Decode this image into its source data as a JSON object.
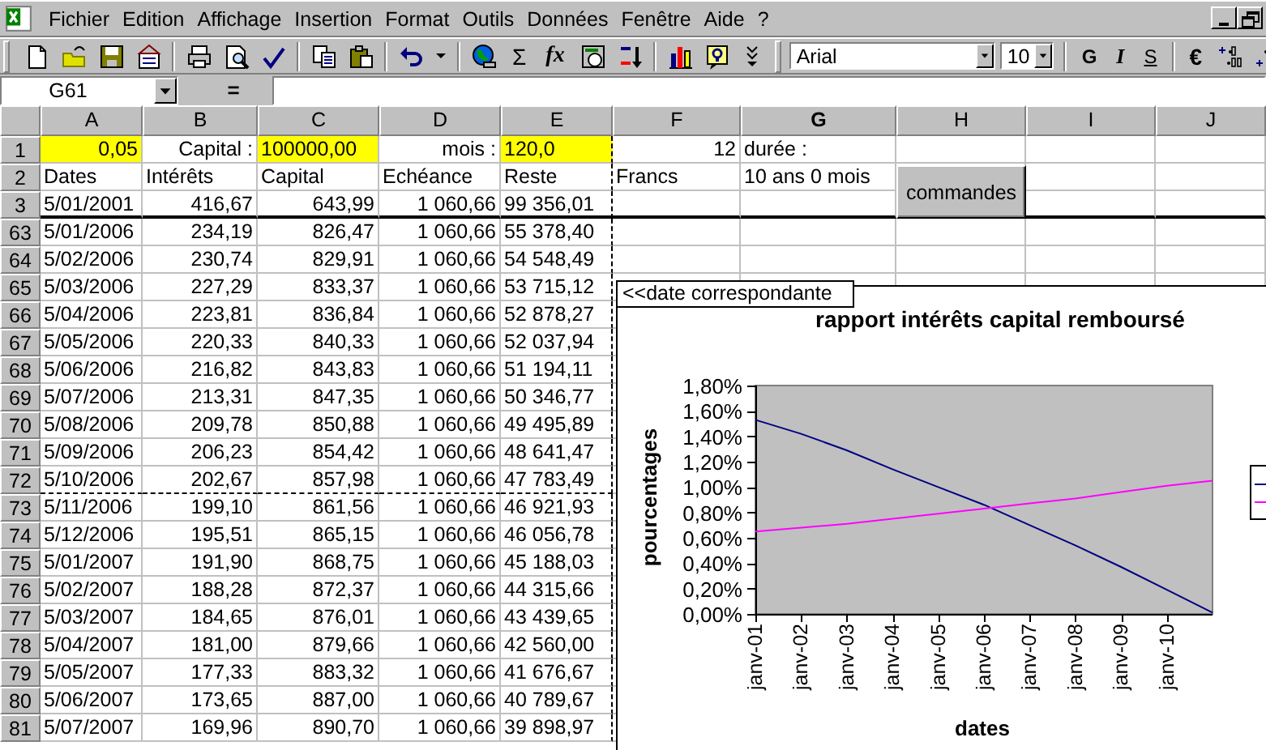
{
  "menu": {
    "items": [
      "Fichier",
      "Edition",
      "Affichage",
      "Insertion",
      "Format",
      "Outils",
      "Données",
      "Fenêtre",
      "Aide",
      "?"
    ]
  },
  "toolbar": {
    "sum": "Σ",
    "function": "fx"
  },
  "formatting_toolbar": {
    "font": "Arial",
    "size": "10",
    "bold": "G",
    "italic": "I",
    "underline": "S",
    "euro": "€"
  },
  "formula_bar": {
    "name_box": "G61",
    "equals": "="
  },
  "sheet": {
    "columns": [
      {
        "label": "A",
        "selected": false
      },
      {
        "label": "B",
        "selected": false
      },
      {
        "label": "C",
        "selected": false
      },
      {
        "label": "D",
        "selected": false
      },
      {
        "label": "E",
        "selected": false
      },
      {
        "label": "F",
        "selected": false
      },
      {
        "label": "G",
        "selected": true
      },
      {
        "label": "H",
        "selected": false
      },
      {
        "label": "I",
        "selected": false
      },
      {
        "label": "J",
        "selected": false
      }
    ],
    "rows": [
      {
        "header": "1",
        "kind": "params",
        "cells": [
          {
            "text": "0,05",
            "highlighted": true
          },
          {
            "text": "Capital :",
            "highlighted": false
          },
          {
            "text": "100000,00",
            "highlighted": true
          },
          {
            "text": "mois :",
            "highlighted": false
          },
          {
            "text": "120,0",
            "highlighted": true
          },
          {
            "text": "12",
            "highlighted": false
          },
          {
            "text": "durée :",
            "highlighted": false
          }
        ]
      },
      {
        "header": "2",
        "kind": "labels",
        "cells": [
          "Dates",
          "Intérêts",
          "Capital",
          "Echéance",
          "Reste",
          "Francs",
          "10 ans 0 mois"
        ]
      },
      {
        "header": "3",
        "kind": "data",
        "cells": [
          "5/01/2001",
          "416,67",
          "643,99",
          "1 060,66",
          "99 356,01"
        ]
      },
      {
        "header": "63",
        "kind": "data",
        "cells": [
          "5/01/2006",
          "234,19",
          "826,47",
          "1 060,66",
          "55 378,40"
        ]
      },
      {
        "header": "64",
        "kind": "data",
        "cells": [
          "5/02/2006",
          "230,74",
          "829,91",
          "1 060,66",
          "54 548,49"
        ]
      },
      {
        "header": "65",
        "kind": "data",
        "cells": [
          "5/03/2006",
          "227,29",
          "833,37",
          "1 060,66",
          "53 715,12"
        ]
      },
      {
        "header": "66",
        "kind": "data",
        "cells": [
          "5/04/2006",
          "223,81",
          "836,84",
          "1 060,66",
          "52 878,27"
        ]
      },
      {
        "header": "67",
        "kind": "data",
        "cells": [
          "5/05/2006",
          "220,33",
          "840,33",
          "1 060,66",
          "52 037,94"
        ]
      },
      {
        "header": "68",
        "kind": "data",
        "cells": [
          "5/06/2006",
          "216,82",
          "843,83",
          "1 060,66",
          "51 194,11"
        ]
      },
      {
        "header": "69",
        "kind": "data",
        "cells": [
          "5/07/2006",
          "213,31",
          "847,35",
          "1 060,66",
          "50 346,77"
        ]
      },
      {
        "header": "70",
        "kind": "data",
        "cells": [
          "5/08/2006",
          "209,78",
          "850,88",
          "1 060,66",
          "49 495,89"
        ]
      },
      {
        "header": "71",
        "kind": "data",
        "cells": [
          "5/09/2006",
          "206,23",
          "854,42",
          "1 060,66",
          "48 641,47"
        ]
      },
      {
        "header": "72",
        "kind": "data",
        "cells": [
          "5/10/2006",
          "202,67",
          "857,98",
          "1 060,66",
          "47 783,49"
        ]
      },
      {
        "header": "73",
        "kind": "data",
        "cells": [
          "5/11/2006",
          "199,10",
          "861,56",
          "1 060,66",
          "46 921,93"
        ]
      },
      {
        "header": "74",
        "kind": "data",
        "cells": [
          "5/12/2006",
          "195,51",
          "865,15",
          "1 060,66",
          "46 056,78"
        ]
      },
      {
        "header": "75",
        "kind": "data",
        "cells": [
          "5/01/2007",
          "191,90",
          "868,75",
          "1 060,66",
          "45 188,03"
        ]
      },
      {
        "header": "76",
        "kind": "data",
        "cells": [
          "5/02/2007",
          "188,28",
          "872,37",
          "1 060,66",
          "44 315,66"
        ]
      },
      {
        "header": "77",
        "kind": "data",
        "cells": [
          "5/03/2007",
          "184,65",
          "876,01",
          "1 060,66",
          "43 439,65"
        ]
      },
      {
        "header": "78",
        "kind": "data",
        "cells": [
          "5/04/2007",
          "181,00",
          "879,66",
          "1 060,66",
          "42 560,00"
        ]
      },
      {
        "header": "79",
        "kind": "data",
        "cells": [
          "5/05/2007",
          "177,33",
          "883,32",
          "1 060,66",
          "41 676,67"
        ]
      },
      {
        "header": "80",
        "kind": "data",
        "cells": [
          "5/06/2007",
          "173,65",
          "887,00",
          "1 060,66",
          "40 789,67"
        ]
      },
      {
        "header": "81",
        "kind": "data",
        "cells": [
          "5/07/2007",
          "169,96",
          "890,70",
          "1 060,66",
          "39 898,97"
        ]
      }
    ],
    "button": "commandes",
    "text_box": "<<date correspondante",
    "chart": {
      "chart_data": {
        "type": "line",
        "title": "rapport intérêts capital remboursé",
        "xlabel": "dates",
        "ylabel": "pourcentages",
        "categories": [
          "janv-01",
          "janv-02",
          "janv-03",
          "janv-04",
          "janv-05",
          "janv-06",
          "janv-07",
          "janv-08",
          "janv-09",
          "janv-10",
          null
        ],
        "ylim": [
          0,
          1.8
        ],
        "yticks": [
          {
            "value": 0,
            "label": "0,00%"
          },
          {
            "value": 0.2,
            "label": "0,20%"
          },
          {
            "value": 0.4,
            "label": "0,40%"
          },
          {
            "value": 0.6,
            "label": "0,60%"
          },
          {
            "value": 0.8,
            "label": "0,80%"
          },
          {
            "value": 1.0,
            "label": "1,00%"
          },
          {
            "value": 1.2,
            "label": "1,20%"
          },
          {
            "value": 1.4,
            "label": "1,40%"
          },
          {
            "value": 1.6,
            "label": "1,60%"
          },
          {
            "value": 1.8,
            "label": "1,80%"
          }
        ],
        "series": [
          {
            "color": "#000080",
            "values": [
              1.53,
              1.42,
              1.29,
              1.14,
              1.0,
              0.86,
              0.7,
              0.54,
              0.37,
              0.19,
              0.01
            ]
          },
          {
            "color": "#ff00ff",
            "values": [
              0.65,
              0.68,
              0.71,
              0.75,
              0.79,
              0.83,
              0.87,
              0.91,
              0.96,
              1.01,
              1.05
            ]
          }
        ]
      }
    }
  }
}
